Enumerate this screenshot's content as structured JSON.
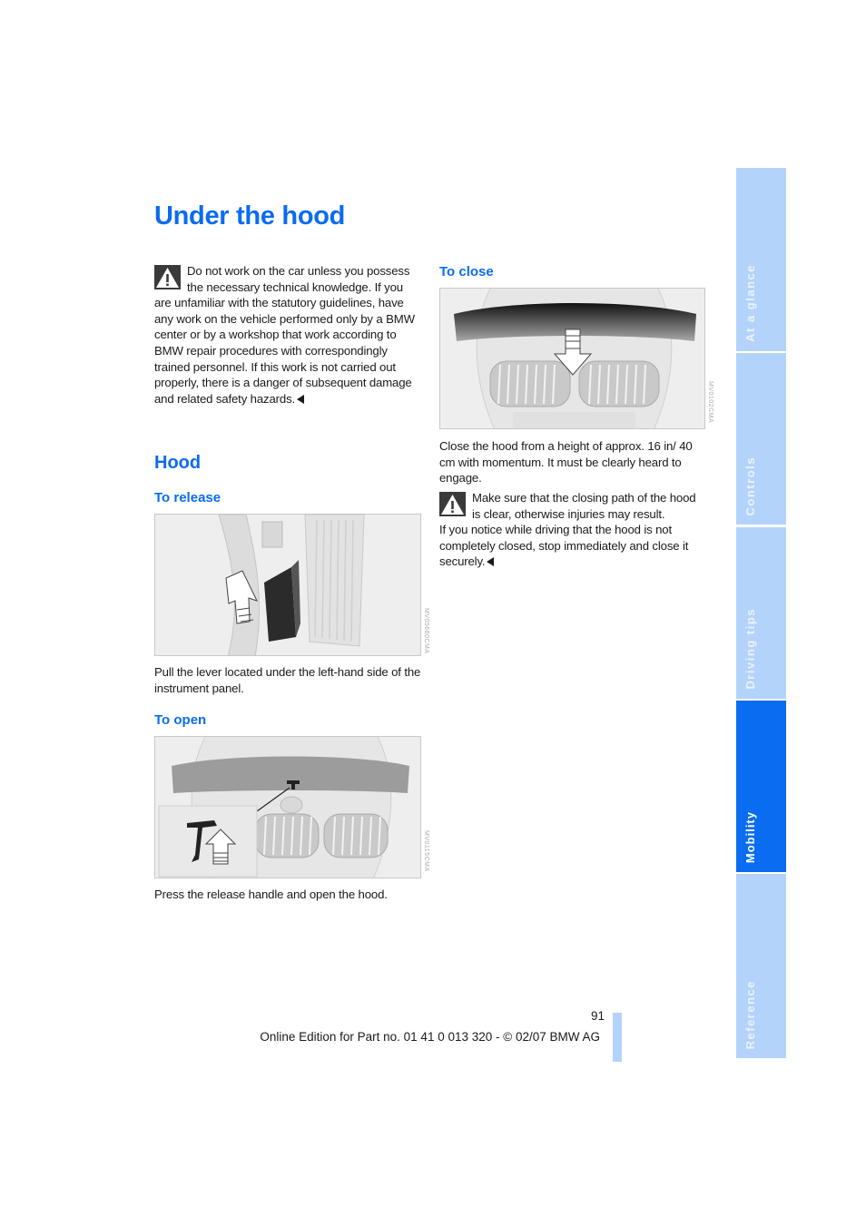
{
  "page": {
    "title": "Under the hood",
    "page_number": "91",
    "footer": "Online Edition for Part no. 01 41 0 013 320 - © 02/07 BMW AG",
    "accent_color": "#0a6cf0",
    "tab_color": "#b3d3fa"
  },
  "left_column": {
    "warning": {
      "icon": "warning-triangle-icon",
      "text": "Do not work on the car unless you possess the necessary technical knowledge. If you are unfamiliar with the statutory guidelines, have any work on the vehicle performed only by a BMW center or by a workshop that work according to BMW repair procedures with correspondingly trained personnel. If this work is not carried out properly, there is a danger of subsequent damage and related safety hazards.",
      "end_mark": "end-of-section-icon"
    },
    "section_title": "Hood",
    "to_release": {
      "heading": "To release",
      "figure_code": "MV05680CMA",
      "text": "Pull the lever located under the left-hand side of the instrument panel."
    },
    "to_open": {
      "heading": "To open",
      "figure_code": "MV0115CMA",
      "text": "Press the release handle and open the hood."
    }
  },
  "right_column": {
    "to_close": {
      "heading": "To close",
      "figure_code": "MV0102CMA",
      "text": "Close the hood from a height of approx. 16 in/ 40 cm with momentum. It must be clearly heard to engage.",
      "warning": {
        "icon": "warning-triangle-icon",
        "text": "Make sure that the closing path of the hood is clear, otherwise injuries may result.",
        "text2": "If you notice while driving that the hood is not completely closed, stop immediately and close it securely."
      }
    }
  },
  "side_tabs": [
    {
      "label": "At a glance",
      "active": false
    },
    {
      "label": "Controls",
      "active": false
    },
    {
      "label": "Driving tips",
      "active": false
    },
    {
      "label": "Mobility",
      "active": true
    },
    {
      "label": "Reference",
      "active": false
    }
  ]
}
